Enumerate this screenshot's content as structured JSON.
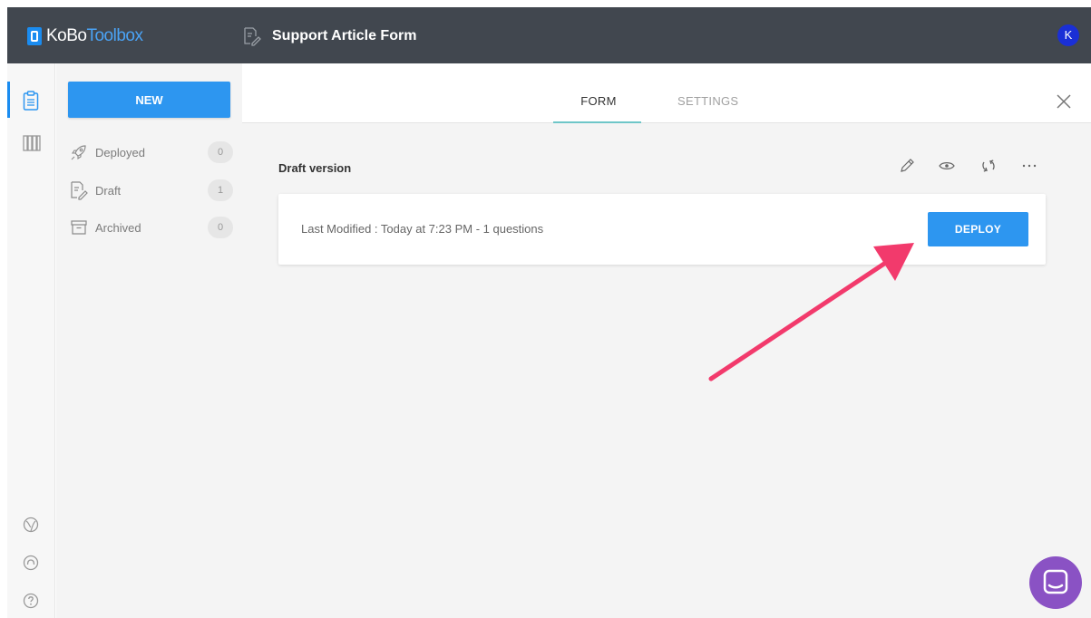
{
  "header": {
    "logo_primary": "KoBo",
    "logo_secondary": "Toolbox",
    "form_title": "Support Article Form",
    "avatar_initial": "K"
  },
  "sidebar": {
    "new_label": "NEW",
    "items": [
      {
        "label": "Deployed",
        "count": "0",
        "icon": "rocket-icon"
      },
      {
        "label": "Draft",
        "count": "1",
        "icon": "draft-icon"
      },
      {
        "label": "Archived",
        "count": "0",
        "icon": "archive-icon"
      }
    ]
  },
  "tabs": {
    "form": "FORM",
    "settings": "SETTINGS"
  },
  "draft": {
    "title": "Draft version",
    "last_modified": "Last Modified : Today at 7:23 PM - 1 questions",
    "deploy_label": "DEPLOY"
  },
  "colors": {
    "brand_blue": "#2d96f0",
    "header_bg": "#41474f",
    "annotation_arrow": "#f23a6c",
    "chat_purple": "#8a52c4"
  }
}
